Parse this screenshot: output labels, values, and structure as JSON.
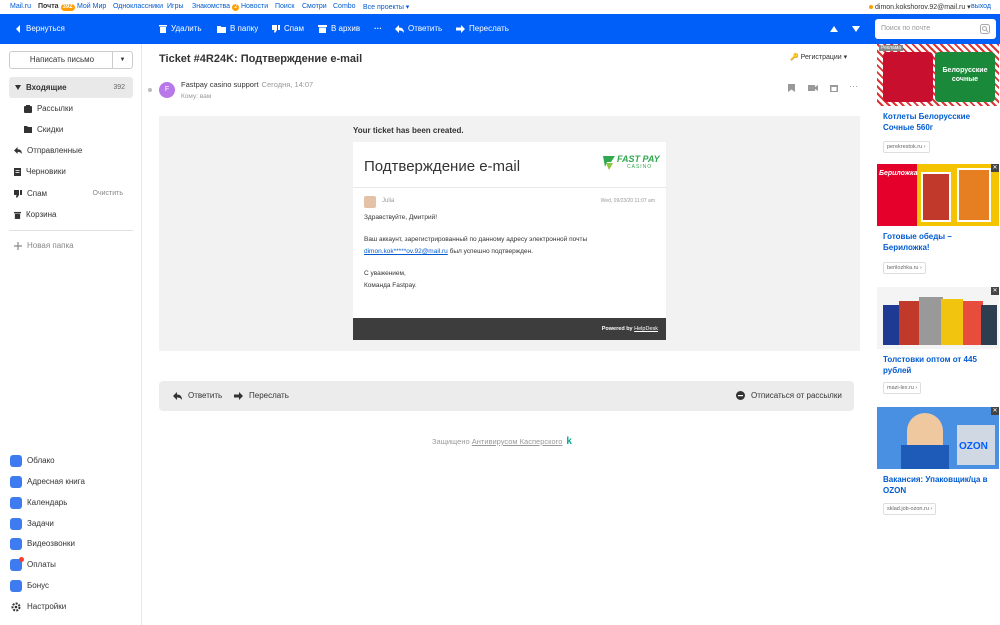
{
  "topnav": {
    "links": [
      "Mail.ru",
      "Почта",
      "Мой Мир",
      "Одноклассники",
      "Игры",
      "Знакомства",
      "Новости",
      "Поиск",
      "Смотри",
      "Combo",
      "Все проекты"
    ],
    "pochta_badge": "392",
    "znakomstva_badge": "2",
    "user_email": "dimon.kokshorov.92@mail.ru",
    "logout": "выход"
  },
  "toolbar": {
    "back": "Вернуться",
    "delete": "Удалить",
    "to_folder": "В папку",
    "spam": "Спам",
    "archive": "В архив",
    "more": "···",
    "reply": "Ответить",
    "forward": "Переслать"
  },
  "search": {
    "placeholder": "Поиск по почте"
  },
  "sidebar": {
    "compose": "Написать письмо",
    "folders": [
      {
        "label": "Входящие",
        "count": "392"
      },
      {
        "label": "Рассылки",
        "count": ""
      },
      {
        "label": "Скидки",
        "count": ""
      },
      {
        "label": "Отправленные",
        "count": ""
      },
      {
        "label": "Черновики",
        "count": ""
      },
      {
        "label": "Спам",
        "count": "Очистить"
      },
      {
        "label": "Корзина",
        "count": ""
      }
    ],
    "new_folder": "Новая папка",
    "apps": [
      "Облако",
      "Адресная книга",
      "Календарь",
      "Задачи",
      "Видеозвонки",
      "Оплаты",
      "Бонус",
      "Настройки"
    ]
  },
  "message": {
    "subject": "Ticket #4R24K: Подтверждение e-mail",
    "category": "Регистрации",
    "avatar_letter": "F",
    "sender": "Fastpay casino support",
    "date": "Сегодня, 14:07",
    "to": "Кому: вам",
    "header_text": "Your ticket has been created.",
    "card_title": "Подтверждение e-mail",
    "logo_top": "FAST PAY",
    "logo_bottom": "CASINO",
    "agent_name": "Julia",
    "agent_date": "Wed, 09/23/20 11:07 am",
    "greeting": "Здравствуйте, Дмитрий!",
    "body_line1": "Ваш аккаунт, зарегистрированный по данному адресу электронной почты",
    "email_link": "dimon.kok*****ov.92@mail.ru",
    "body_line2": " был успешно подтвержден.",
    "sign1": "С уважением,",
    "sign2": "Команда Fastpay.",
    "powered": "Powered by",
    "powered_link": "HelpDesk"
  },
  "replybar": {
    "reply": "Ответить",
    "forward": "Переслать",
    "unsubscribe": "Отписаться от рассылки"
  },
  "footer": {
    "protected": "Защищено",
    "antivirus": "Антивирусом Касперского"
  },
  "ads": [
    {
      "title": "Котлеты Белорусские Сочные 560г",
      "domain": "perekrestok.ru",
      "label": "Реклама",
      "brand": "Белорусские сочные"
    },
    {
      "title": "Готовые обеды – Бериложка!",
      "domain": "berilozhka.ru",
      "brand": "Бериложка"
    },
    {
      "title": "Толстовки оптом от 445 рублей",
      "domain": "mazi-lex.ru"
    },
    {
      "title": "Вакансия: Упаковщик/ца в OZON",
      "domain": "sklad.job-ozon.ru",
      "brand": "OZON"
    }
  ],
  "colors": {
    "accent": "#005ff9",
    "link": "#005bd1",
    "bg_letter": "#f2f2f2"
  }
}
